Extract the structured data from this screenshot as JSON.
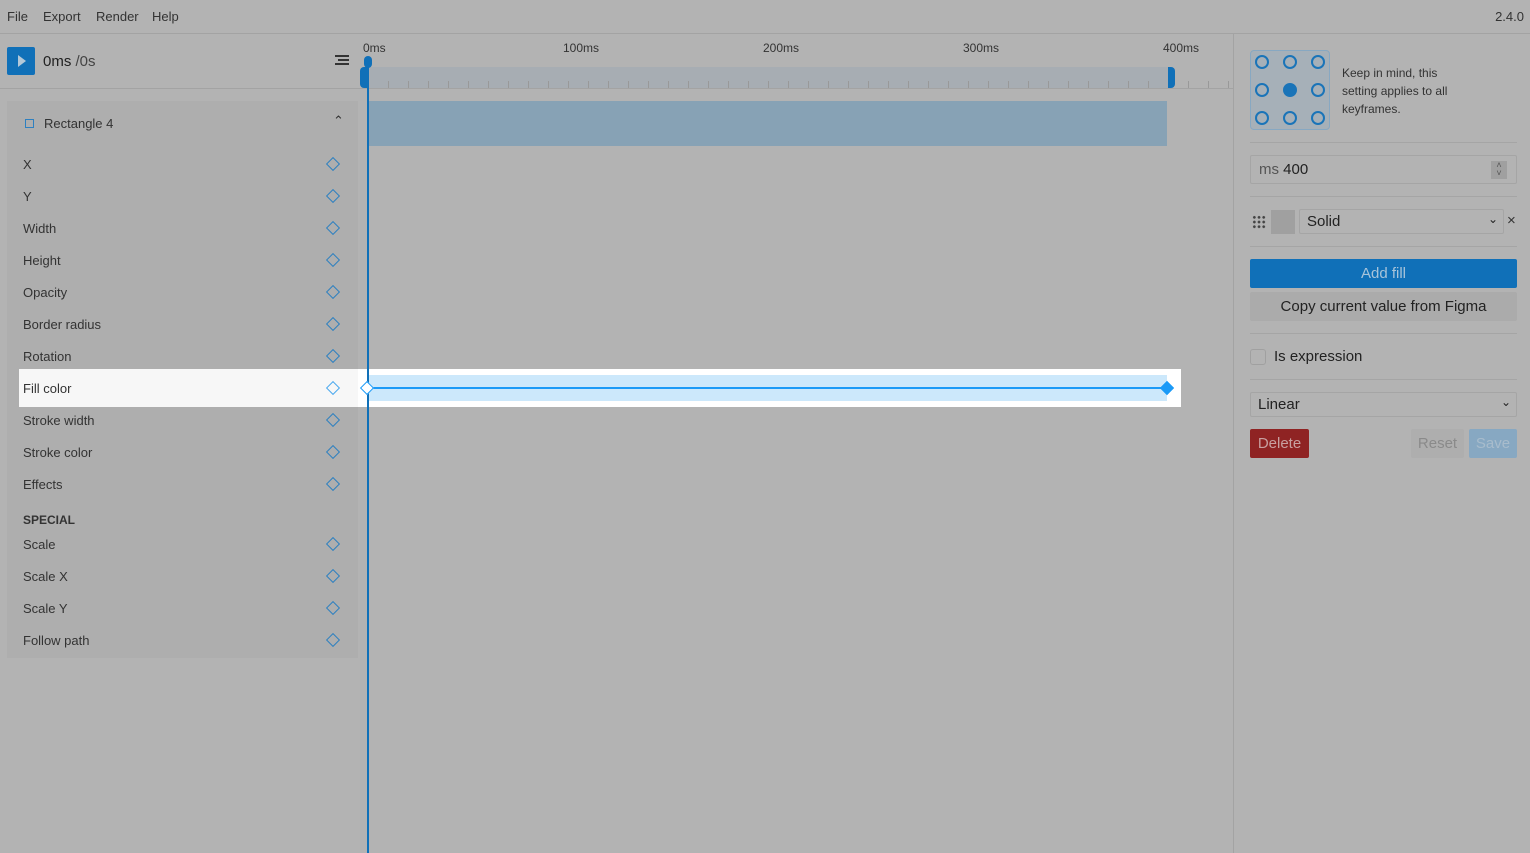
{
  "menu": [
    "File",
    "Export",
    "Render",
    "Help"
  ],
  "version": "2.4.0",
  "player": {
    "current": "0ms",
    "total": "/0s"
  },
  "timeline": {
    "ticks": [
      "0ms",
      "100ms",
      "200ms",
      "300ms",
      "400ms"
    ],
    "duration_ms": 400,
    "keyframes_ms": [
      0,
      400
    ]
  },
  "layer": {
    "name": "Rectangle 4",
    "props": [
      "X",
      "Y",
      "Width",
      "Height",
      "Opacity",
      "Border radius",
      "Rotation",
      "Fill color",
      "Stroke width",
      "Stroke color",
      "Effects"
    ],
    "special_label": "SPECIAL",
    "special": [
      "Scale",
      "Scale X",
      "Scale Y",
      "Follow path"
    ],
    "selected": "Fill color"
  },
  "right": {
    "note": "Keep in mind, this setting applies to all keyframes.",
    "unit": "ms",
    "time_value": "400",
    "fill_type": "Solid",
    "add_fill": "Add fill",
    "copy": "Copy current value from Figma",
    "is_expression": "Is expression",
    "easing": "Linear",
    "delete": "Delete",
    "reset": "Reset",
    "save": "Save"
  },
  "colors": {
    "accent": "#1070b8",
    "delete": "#8f2323",
    "keyframe": "#1b9af7"
  }
}
